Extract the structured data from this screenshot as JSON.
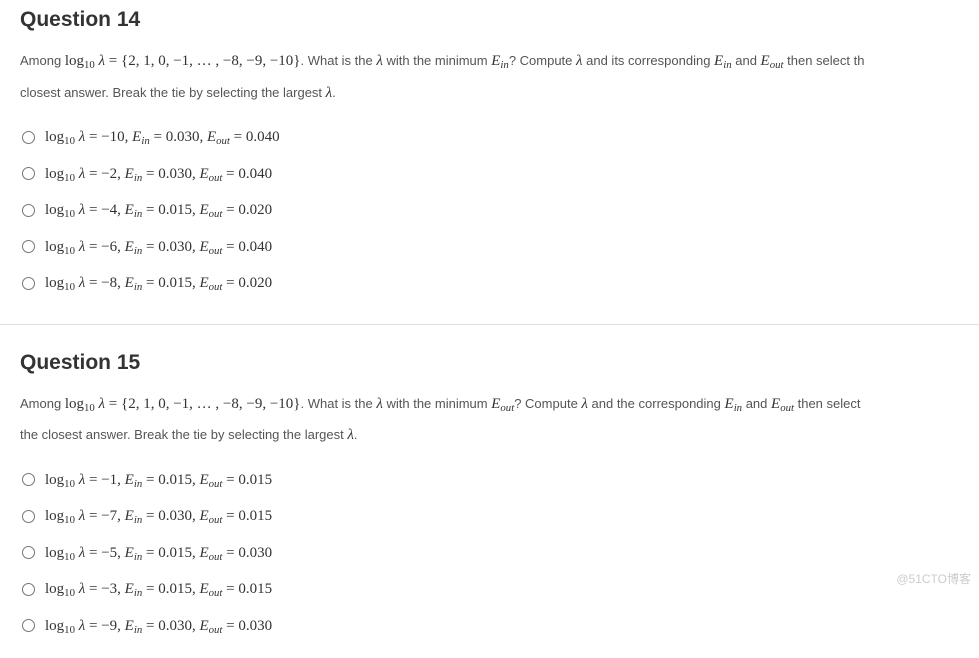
{
  "q14": {
    "title": "Question 14",
    "prompt_pre": "Among ",
    "prompt_set": "log₁₀ λ = {2, 1, 0, −1, … , −8, −9, −10}",
    "prompt_mid1": ". What is the ",
    "prompt_lambda": "λ",
    "prompt_mid2": " with the minimum ",
    "prompt_ein": "E",
    "prompt_ein_sub": "in",
    "prompt_mid3": "? Compute ",
    "prompt_mid4": " and its corresponding ",
    "prompt_mid5": " and ",
    "prompt_eout": "E",
    "prompt_eout_sub": "out",
    "prompt_mid6": " then select th",
    "prompt_line2": "closest answer. Break the tie by selecting the largest ",
    "prompt_end": ".",
    "choices": [
      "log₁₀ λ = −10, Eᵢₙ = 0.030, Eₒᵤₜ = 0.040",
      "log₁₀ λ = −2, Eᵢₙ = 0.030, Eₒᵤₜ = 0.040",
      "log₁₀ λ = −4, Eᵢₙ = 0.015, Eₒᵤₜ = 0.020",
      "log₁₀ λ = −6, Eᵢₙ = 0.030, Eₒᵤₜ = 0.040",
      "log₁₀ λ = −8, Eᵢₙ = 0.015, Eₒᵤₜ = 0.020"
    ],
    "choice_vals": [
      {
        "log": "−10",
        "ein": "0.030",
        "eout": "0.040"
      },
      {
        "log": "−2",
        "ein": "0.030",
        "eout": "0.040"
      },
      {
        "log": "−4",
        "ein": "0.015",
        "eout": "0.020"
      },
      {
        "log": "−6",
        "ein": "0.030",
        "eout": "0.040"
      },
      {
        "log": "−8",
        "ein": "0.015",
        "eout": "0.020"
      }
    ]
  },
  "q15": {
    "title": "Question 15",
    "prompt_pre": "Among ",
    "prompt_set": "log₁₀ λ = {2, 1, 0, −1, … , −8, −9, −10}",
    "prompt_mid1": ". What is the ",
    "prompt_lambda": "λ",
    "prompt_mid2": " with the minimum ",
    "prompt_eout": "E",
    "prompt_eout_sub": "out",
    "prompt_mid3": "? Compute ",
    "prompt_mid4": " and the corresponding ",
    "prompt_ein": "E",
    "prompt_ein_sub": "in",
    "prompt_mid5": " and ",
    "prompt_mid6": " then select",
    "prompt_line2": "the closest answer. Break the tie by selecting the largest ",
    "prompt_end": ".",
    "choices": [
      "log₁₀ λ = −1, Eᵢₙ = 0.015, Eₒᵤₜ = 0.015",
      "log₁₀ λ = −7, Eᵢₙ = 0.030, Eₒᵤₜ = 0.015",
      "log₁₀ λ = −5, Eᵢₙ = 0.015, Eₒᵤₜ = 0.030",
      "log₁₀ λ = −3, Eᵢₙ = 0.015, Eₒᵤₜ = 0.015",
      "log₁₀ λ = −9, Eᵢₙ = 0.030, Eₒᵤₜ = 0.030"
    ],
    "choice_vals": [
      {
        "log": "−1",
        "ein": "0.015",
        "eout": "0.015"
      },
      {
        "log": "−7",
        "ein": "0.030",
        "eout": "0.015"
      },
      {
        "log": "−5",
        "ein": "0.015",
        "eout": "0.030"
      },
      {
        "log": "−3",
        "ein": "0.015",
        "eout": "0.015"
      },
      {
        "log": "−9",
        "ein": "0.030",
        "eout": "0.030"
      }
    ]
  },
  "watermark": "@51CTO博客"
}
